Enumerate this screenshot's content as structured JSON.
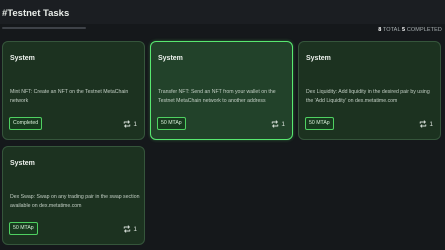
{
  "page": {
    "title": "#Testnet Tasks"
  },
  "progress": {
    "total_count": "8",
    "total_label": "TOTAL",
    "completed_count": "5",
    "completed_label": "COMPLETED"
  },
  "tasks": [
    {
      "category": "System",
      "description": "Mint NFT: Create an NFT on the Testnet MetaChain network",
      "badge": "Completed",
      "count": "1"
    },
    {
      "category": "System",
      "description": "Transfer NFT: Send an NFT from your wallet on the Testnet MetaChain network to another address",
      "badge": "50 MTAp",
      "count": "1"
    },
    {
      "category": "System",
      "description": "Dex Liquidity: Add liquidity in the desired pair by using the 'Add Liquidity' on dex.metatime.com",
      "badge": "50 MTAp",
      "count": "1"
    },
    {
      "category": "System",
      "description": "Dex Swap: Swap on any trading pair in the swap section available on dex.metatime.com",
      "badge": "50 MTAp",
      "count": "1"
    }
  ],
  "colors": {
    "accent": "#58e870",
    "card_bg": "#1c3220",
    "page_bg": "#15181b"
  },
  "icons": {
    "repeat": "repeat-icon"
  }
}
